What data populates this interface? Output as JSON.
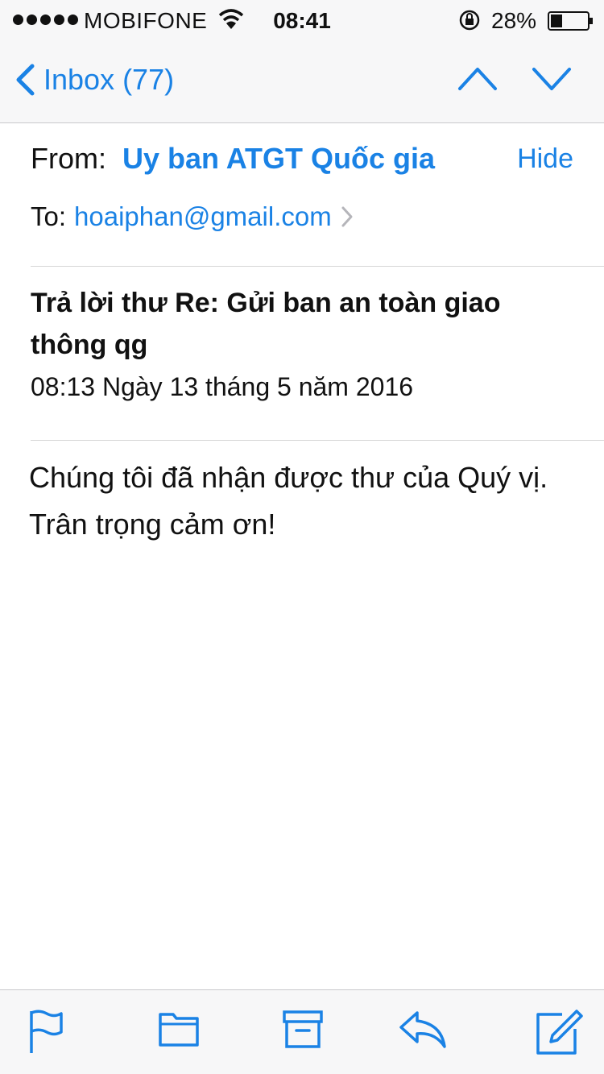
{
  "status_bar": {
    "carrier": "MOBIFONE",
    "time": "08:41",
    "battery": "28%"
  },
  "nav": {
    "back_label": "Inbox (77)"
  },
  "email": {
    "from_label": "From:",
    "from_name": "Uy ban ATGT Quốc gia",
    "hide_label": "Hide",
    "to_label": "To:",
    "to_address": "hoaiphan@gmail.com",
    "subject": "Trả lời thư Re: Gửi ban an toàn giao thông qg",
    "date": "08:13 Ngày 13 tháng 5 năm 2016",
    "body": "Chúng tôi đã nhận được thư của Quý vị. Trân trọng cảm ơn!"
  },
  "colors": {
    "accent": "#1a82e5",
    "bar_background": "#f7f7f8"
  },
  "toolbar": {
    "icons": [
      "flag-icon",
      "folder-icon",
      "archive-icon",
      "reply-icon",
      "compose-icon"
    ]
  }
}
